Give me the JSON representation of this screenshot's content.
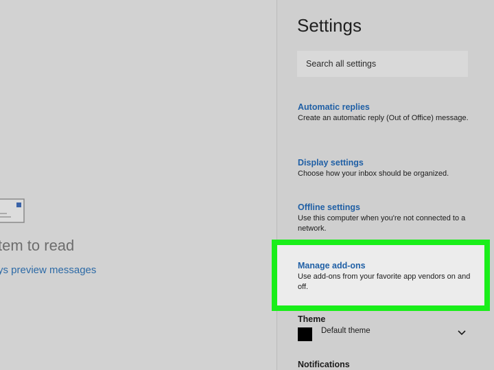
{
  "reading_pane": {
    "icon": "envelope-icon",
    "empty_title": "tem to read",
    "empty_link": "ys preview messages"
  },
  "settings": {
    "title": "Settings",
    "search_placeholder": "Search all settings",
    "items": [
      {
        "title": "Automatic replies",
        "description": "Create an automatic reply (Out of Office) message."
      },
      {
        "title": "Display settings",
        "description": "Choose how your inbox should be organized."
      },
      {
        "title": "Offline settings",
        "description": "Use this computer when you're not connected to a network."
      },
      {
        "title": "Manage add-ons",
        "description": "Use add-ons from your favorite app vendors on and off."
      }
    ],
    "theme": {
      "label": "Theme",
      "value": "Default theme",
      "icon": "chevron-down-icon"
    },
    "notifications_label": "Notifications"
  },
  "colors": {
    "highlight": "#19ee19",
    "link": "#1f5fa5",
    "background": "#d2d2d2"
  }
}
